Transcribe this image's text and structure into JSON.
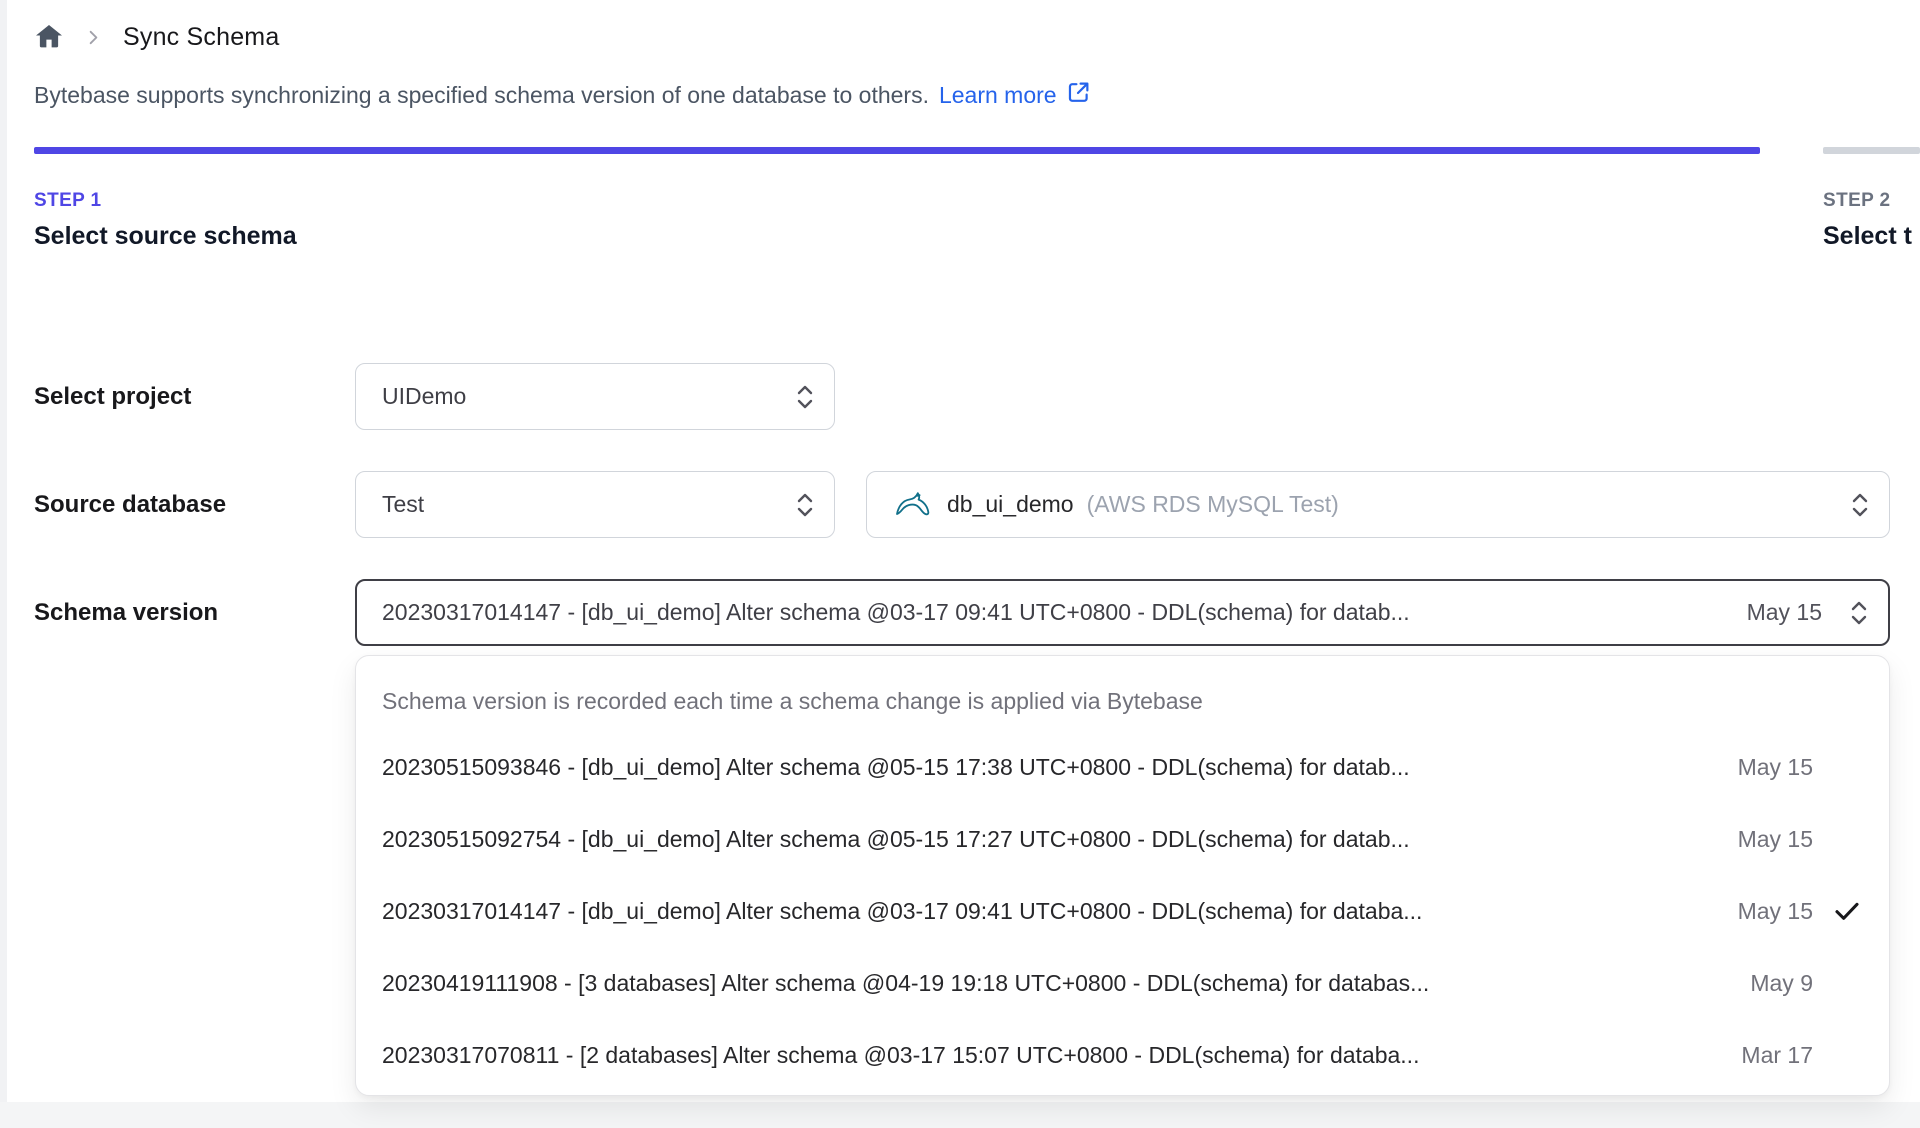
{
  "breadcrumb": {
    "page_title": "Sync Schema"
  },
  "intro": {
    "text": "Bytebase supports synchronizing a specified schema version of one database to others.",
    "learn_more_label": "Learn more"
  },
  "steps": {
    "step1": {
      "label": "STEP 1",
      "title": "Select source schema"
    },
    "step2": {
      "label": "STEP 2",
      "title": "Select t"
    }
  },
  "form": {
    "project_label": "Select project",
    "project_value": "UIDemo",
    "source_db_label": "Source database",
    "environment_value": "Test",
    "database_name": "db_ui_demo",
    "database_detail": "(AWS RDS MySQL Test)",
    "schema_version_label": "Schema version",
    "schema_version_value": "20230317014147 - [db_ui_demo] Alter schema @03-17 09:41 UTC+0800 - DDL(schema) for datab...",
    "schema_version_date": "May 15"
  },
  "dropdown": {
    "header": "Schema version is recorded each time a schema change is applied via Bytebase",
    "options": [
      {
        "text": "20230515093846 - [db_ui_demo] Alter schema @05-15 17:38 UTC+0800 - DDL(schema) for datab...",
        "date": "May 15",
        "selected": false
      },
      {
        "text": "20230515092754 - [db_ui_demo] Alter schema @05-15 17:27 UTC+0800 - DDL(schema) for datab...",
        "date": "May 15",
        "selected": false
      },
      {
        "text": "20230317014147 - [db_ui_demo] Alter schema @03-17 09:41 UTC+0800 - DDL(schema) for databa...",
        "date": "May 15",
        "selected": true
      },
      {
        "text": "20230419111908 - [3 databases] Alter schema @04-19 19:18 UTC+0800 - DDL(schema) for databas...",
        "date": "May 9",
        "selected": false
      },
      {
        "text": "20230317070811 - [2 databases] Alter schema @03-17 15:07 UTC+0800 - DDL(schema) for databa...",
        "date": "Mar 17",
        "selected": false
      }
    ]
  },
  "colors": {
    "accent": "#4f46e5",
    "link": "#2563eb",
    "mysql_teal": "#11708a"
  }
}
